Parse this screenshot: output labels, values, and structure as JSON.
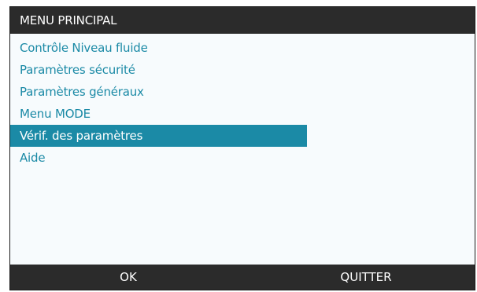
{
  "title": "MENU PRINCIPAL",
  "menu": {
    "items": [
      {
        "label": "Contrôle Niveau fluide"
      },
      {
        "label": "Paramètres sécurité"
      },
      {
        "label": "Paramètres généraux"
      },
      {
        "label": "Menu MODE"
      },
      {
        "label": "Vérif. des paramètres"
      },
      {
        "label": "Aide"
      }
    ],
    "selected_label": "Vérif. des paramètres"
  },
  "softkeys": {
    "left": "OK",
    "right": "QUITTER"
  },
  "colors": {
    "titlebar": "#2b2b2b",
    "accent": "#1b8aa6",
    "screen_background": "#f7fbfd"
  }
}
